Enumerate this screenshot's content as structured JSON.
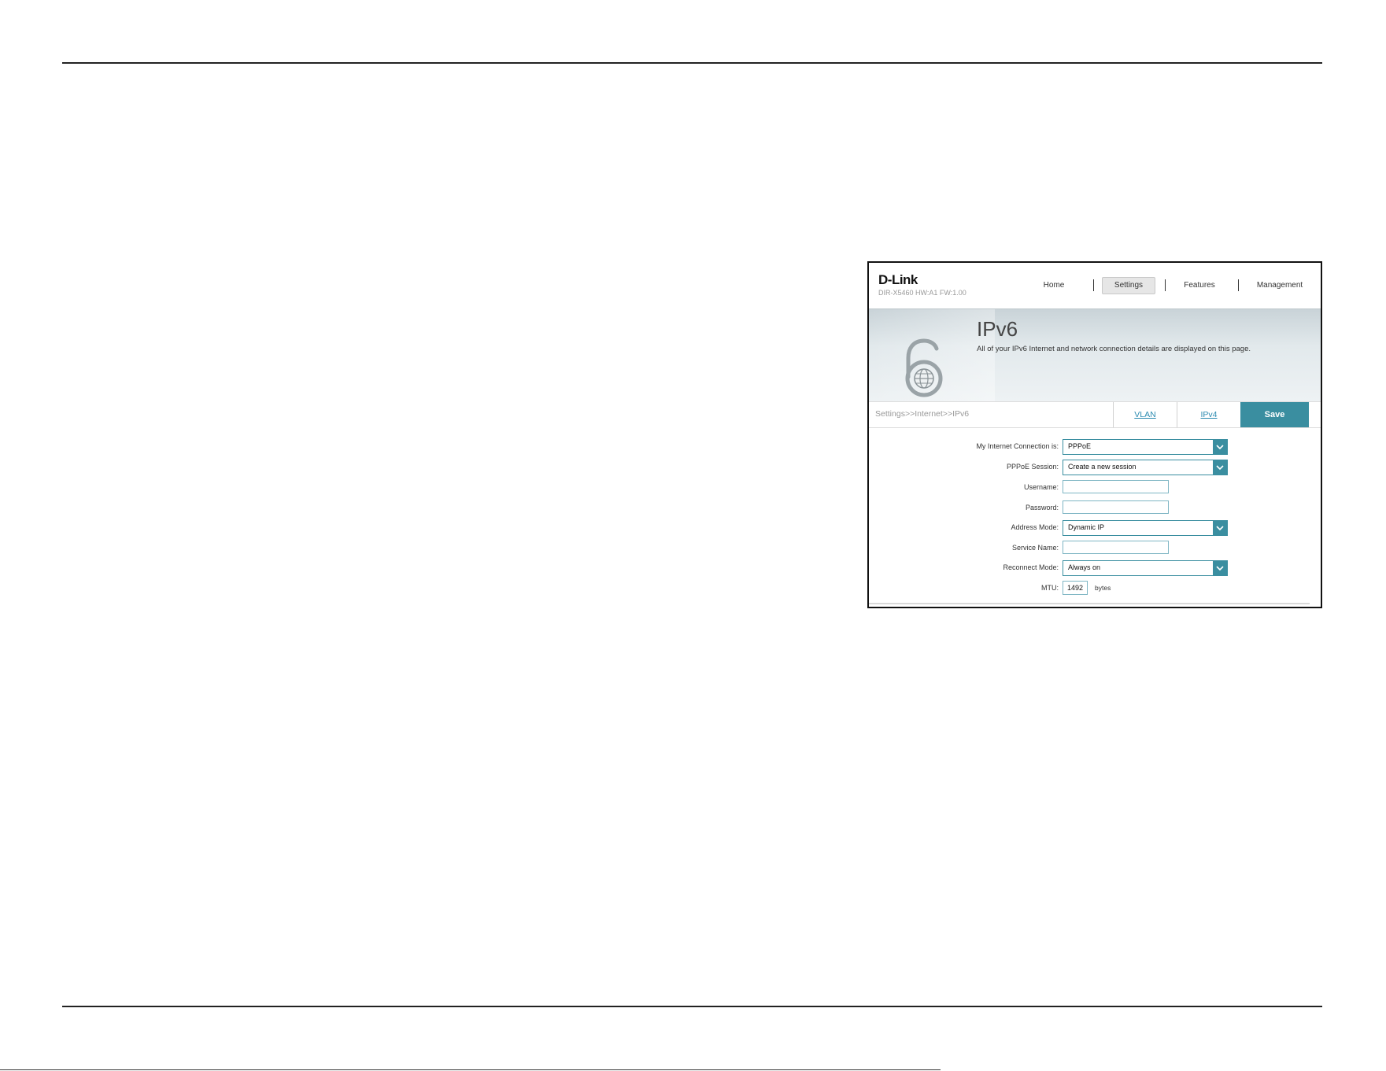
{
  "app": {
    "logo": "D-Link",
    "model_info": "DIR-X5460 HW:A1 FW:1.00"
  },
  "nav": {
    "home": "Home",
    "settings": "Settings",
    "features": "Features",
    "management": "Management"
  },
  "banner": {
    "title": "IPv6",
    "description": "All of your IPv6 Internet and network connection details are displayed on this page."
  },
  "breadcrumb": "Settings>>Internet>>IPv6",
  "tabs": {
    "vlan": "VLAN",
    "ipv4": "IPv4",
    "save": "Save"
  },
  "form": {
    "connection": {
      "label": "My Internet Connection is:",
      "value": "PPPoE"
    },
    "session": {
      "label": "PPPoE Session:",
      "value": "Create a new session"
    },
    "username": {
      "label": "Username:",
      "value": ""
    },
    "password": {
      "label": "Password:",
      "value": ""
    },
    "address_mode": {
      "label": "Address Mode:",
      "value": "Dynamic IP"
    },
    "service_name": {
      "label": "Service Name:",
      "value": ""
    },
    "reconnect_mode": {
      "label": "Reconnect Mode:",
      "value": "Always on"
    },
    "mtu": {
      "label": "MTU:",
      "value": "1492",
      "unit": "bytes"
    }
  },
  "colors": {
    "accent": "#3a8ea0",
    "link": "#2a8ab0"
  },
  "icons": {
    "lock": "ipv6-lock-icon",
    "dropdown": "chevron-down-icon"
  }
}
